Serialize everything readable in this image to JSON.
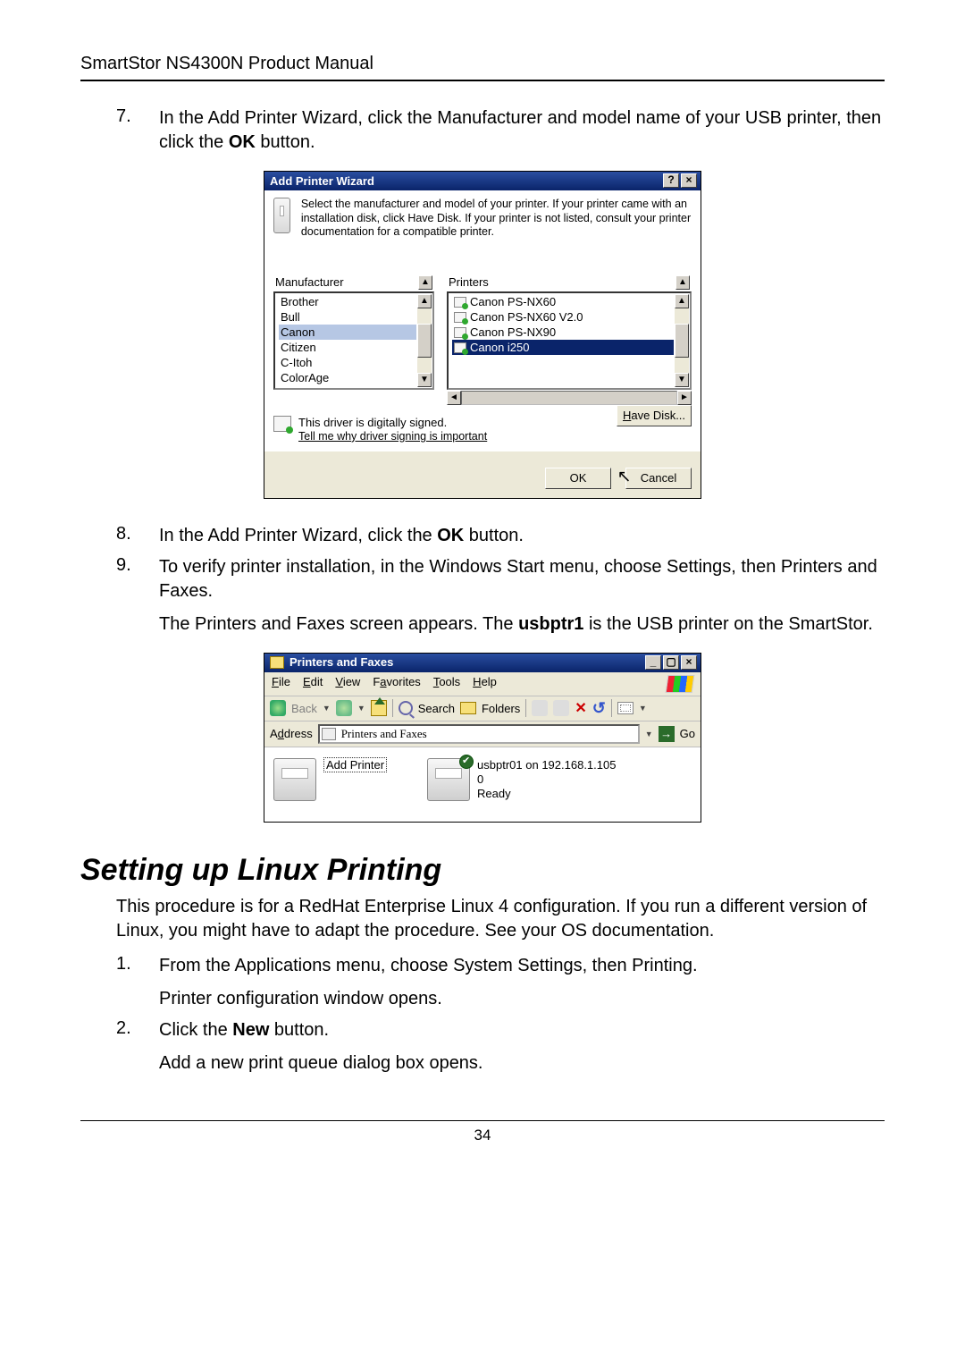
{
  "doc": {
    "header": "SmartStor NS4300N Product Manual",
    "page_number": "34",
    "section_heading": "Setting up Linux Printing",
    "section_intro": "This procedure is for a RedHat Enterprise Linux 4 configuration. If you run a different version of Linux, you might have to adapt the procedure. See your OS documentation.",
    "step7a": "In the Add Printer Wizard, click the Manufacturer and model name of your USB printer, then click the ",
    "step7b": "OK",
    "step7c": " button.",
    "step8a": "In the Add Printer Wizard, click the ",
    "step8b": "OK",
    "step8c": " button.",
    "step9a": "To verify printer installation, in the Windows Start menu, choose Settings, then Printers and Faxes.",
    "step9b_a": "The Printers and Faxes screen appears. The ",
    "step9b_b": "usbptr1",
    "step9b_c": " is the USB printer on the SmartStor.",
    "linux_step1a": "From the Applications menu, choose System Settings, then Printing.",
    "linux_step1b": "Printer configuration window opens.",
    "linux_step2a_a": "Click the ",
    "linux_step2a_b": "New",
    "linux_step2a_c": " button.",
    "linux_step2b": "Add a new print queue dialog box opens."
  },
  "apw": {
    "title": "Add Printer Wizard",
    "help_text": "Select the manufacturer and model of your printer. If your printer came with an installation disk, click Have Disk. If your printer is not listed, consult your printer documentation for a compatible printer.",
    "manufacturer_label": "Manufacturer",
    "printers_label": "Printers",
    "manufacturers": [
      "Brother",
      "Bull",
      "Canon",
      "Citizen",
      "C-Itoh",
      "ColorAge"
    ],
    "manufacturer_selected": "Canon",
    "printers": [
      "Canon PS-NX60",
      "Canon PS-NX60 V2.0",
      "Canon PS-NX90",
      "Canon i250"
    ],
    "printer_selected": "Canon i250",
    "signed_line": "This driver is digitally signed.",
    "signed_link": "Tell me why driver signing is important",
    "have_disk": "Have Disk...",
    "ok": "OK",
    "cancel": "Cancel"
  },
  "pf": {
    "title": "Printers and Faxes",
    "menus": {
      "file": "File",
      "edit": "Edit",
      "view": "View",
      "favorites": "Favorites",
      "tools": "Tools",
      "help": "Help"
    },
    "toolbar": {
      "back": "Back",
      "search": "Search",
      "folders": "Folders"
    },
    "address_label": "Address",
    "address_value": "Printers and Faxes",
    "go": "Go",
    "items": {
      "add_printer": "Add Printer",
      "usb_name": "usbptr01 on 192.168.1.105",
      "usb_docs": "0",
      "usb_status": "Ready"
    }
  }
}
